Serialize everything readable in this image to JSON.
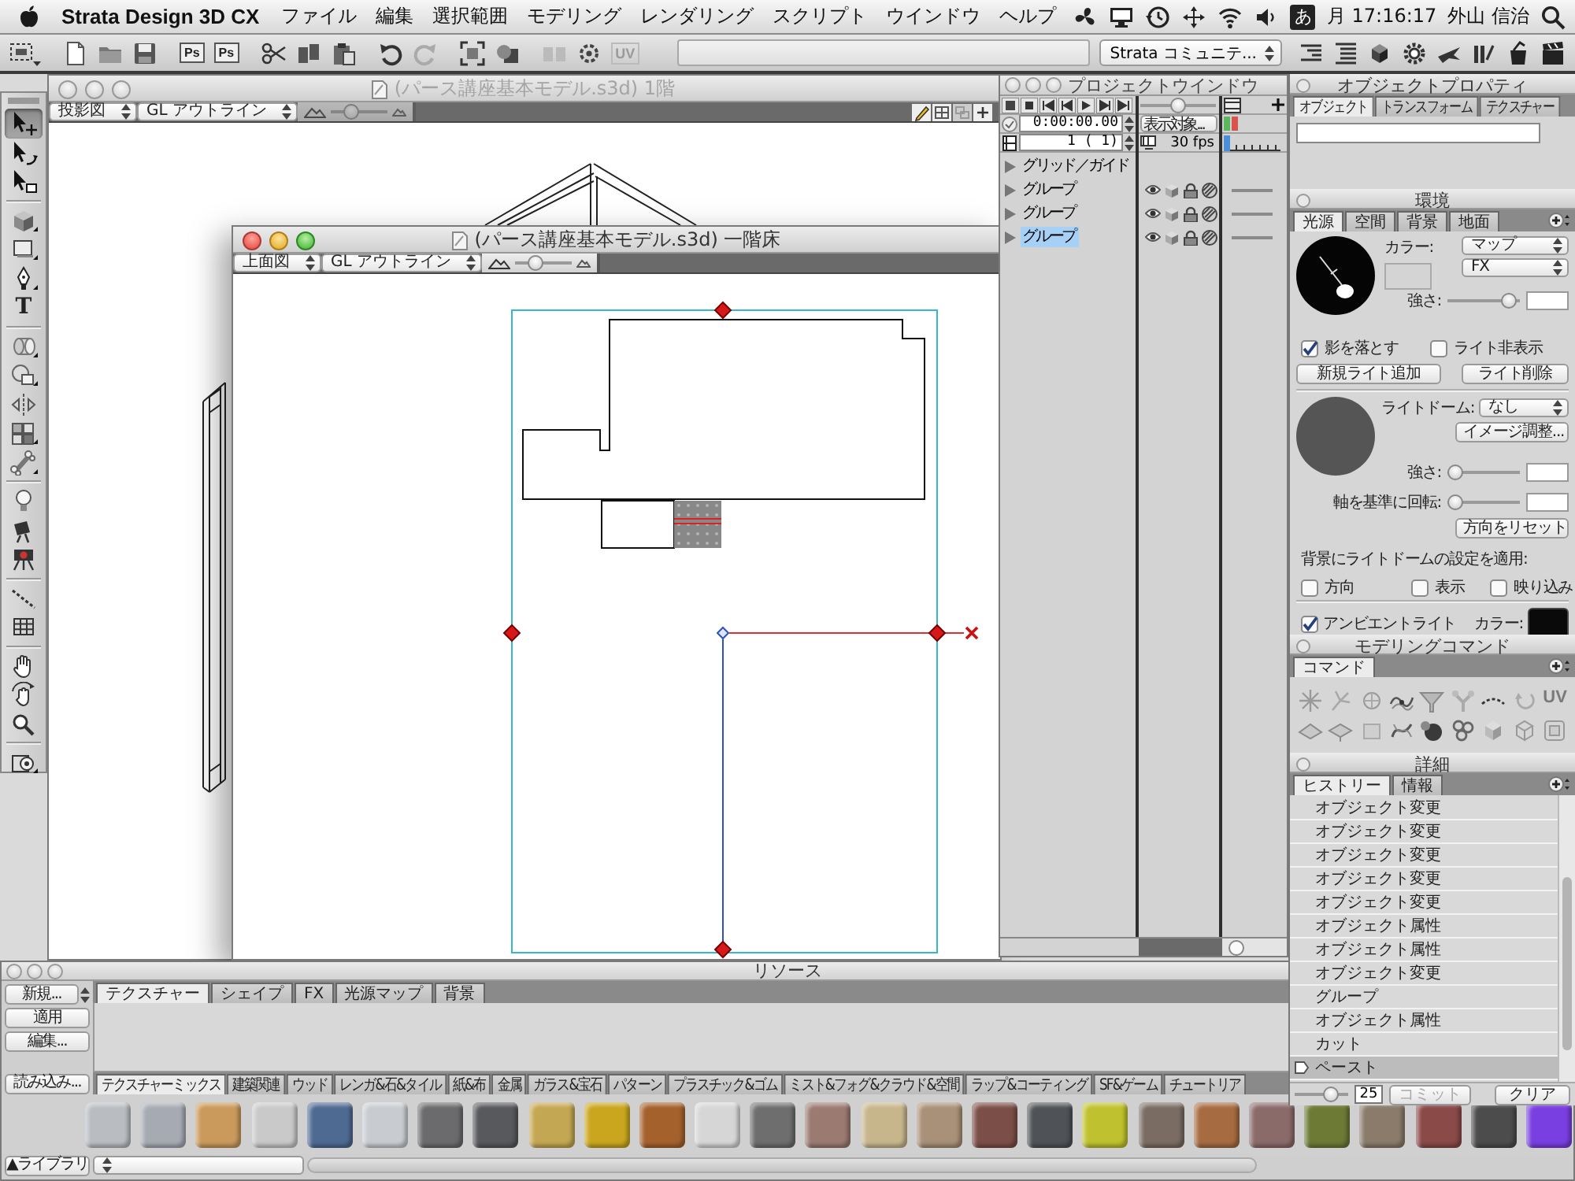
{
  "menu_bar": {
    "app_name": "Strata Design 3D CX",
    "menus": [
      "ファイル",
      "編集",
      "選択範囲",
      "モデリング",
      "レンダリング",
      "スクリプト",
      "ウインドウ",
      "ヘルプ"
    ],
    "input_mode": "あ",
    "clock": "月 17:16:17",
    "user": "外山 信治"
  },
  "toolbar": {
    "export_buttons": [
      "Ps",
      "Ps"
    ],
    "uv_button": "UV",
    "community_select": "Strata コミュニテ..."
  },
  "toolbox": {
    "groups": [
      [
        {
          "kind": "move",
          "selected": true
        },
        {
          "kind": "rotate",
          "selected": false
        },
        {
          "kind": "reshape",
          "selected": false
        }
      ],
      [
        {
          "kind": "cube",
          "selected": false
        },
        {
          "kind": "rectangle",
          "selected": false
        },
        {
          "kind": "pen",
          "selected": false
        },
        {
          "kind": "text",
          "label": "T",
          "selected": false
        }
      ],
      [
        {
          "kind": "extrude",
          "selected": false
        },
        {
          "kind": "lathe",
          "selected": false
        },
        {
          "kind": "mirror",
          "selected": false
        },
        {
          "kind": "replicate",
          "selected": false
        },
        {
          "kind": "bone",
          "selected": false
        }
      ],
      [
        {
          "kind": "light",
          "selected": false
        },
        {
          "kind": "spotlight",
          "selected": false
        },
        {
          "kind": "camera",
          "selected": false
        }
      ],
      [
        {
          "kind": "path",
          "selected": false
        },
        {
          "kind": "grid",
          "selected": false
        }
      ],
      [
        {
          "kind": "hand",
          "selected": false
        },
        {
          "kind": "orbit",
          "selected": false
        },
        {
          "kind": "zoom",
          "selected": false
        }
      ],
      [
        {
          "kind": "render",
          "selected": false
        }
      ]
    ]
  },
  "back_window": {
    "title": "(パース講座基本モデル.s3d) 1階",
    "active": false,
    "view_select": "投影図",
    "render_select": "GL アウトライン",
    "zoom_slider": {
      "level": 0.3
    }
  },
  "front_window": {
    "title": "(パース講座基本モデル.s3d) 一階床",
    "active": true,
    "view_select": "上面図",
    "render_select": "GL アウトライン",
    "zoom_slider": {
      "level": 0.3
    }
  },
  "project_window": {
    "title": "プロジェクトウインドウ",
    "active": false,
    "time": "0:00:00.00",
    "frame": "1 ( 1)",
    "scale_slider": {
      "level": 0.5
    },
    "display_button": "表示対象...",
    "fps": "30 fps",
    "items": [
      {
        "kind": "guide",
        "label": "グリッド／ガイド",
        "selected": false
      },
      {
        "kind": "group",
        "label": "グループ",
        "selected": false
      },
      {
        "kind": "group",
        "label": "グループ",
        "selected": false
      },
      {
        "kind": "group",
        "label": "グループ",
        "selected": true
      }
    ]
  },
  "object_properties": {
    "title": "オブジェクトプロパティ",
    "tabs": [
      {
        "label": "オブジェクト",
        "selected": true
      },
      {
        "label": "トランスフォーム",
        "selected": false
      },
      {
        "label": "テクスチャー",
        "selected": false
      }
    ]
  },
  "environment": {
    "title": "環境",
    "tabs": [
      {
        "label": "光源",
        "selected": true
      },
      {
        "label": "空間",
        "selected": false
      },
      {
        "label": "背景",
        "selected": false
      },
      {
        "label": "地面",
        "selected": false
      }
    ],
    "color_label": "カラー:",
    "map_select": "マップ",
    "fx_select": "FX",
    "intensity": {
      "label": "強さ:",
      "level": 0.95
    },
    "cast_shadow": {
      "label": "影を落とす",
      "checked": true
    },
    "hide_light": {
      "label": "ライト非表示",
      "checked": false
    },
    "add_light_button": "新規ライト追加",
    "delete_light_button": "ライト削除",
    "dome_label": "ライトドーム:",
    "dome_select": "なし",
    "image_adjust_button": "イメージ調整...",
    "dome_intensity": {
      "label": "強さ:",
      "level": 0
    },
    "rotation": {
      "label": "軸を基準に回転:",
      "level": 0
    },
    "reset_button": "方向をリセット",
    "apply_label": "背景にライトドームの設定を適用:",
    "apply_options": [
      {
        "label": "方向",
        "checked": false
      },
      {
        "label": "表示",
        "checked": false
      },
      {
        "label": "映り込み",
        "checked": false
      }
    ],
    "ambient": {
      "label": "アンビエントライト",
      "checked": true
    },
    "ambient_color_label": "カラー:"
  },
  "modeling_commands": {
    "title": "モデリングコマンド",
    "tab": "コマンド",
    "uv_label": "UV"
  },
  "details": {
    "title": "詳細",
    "tabs": [
      {
        "label": "ヒストリー",
        "selected": true
      },
      {
        "label": "情報",
        "selected": false
      }
    ],
    "history": [
      {
        "label": "オブジェクト変更",
        "selected": false
      },
      {
        "label": "オブジェクト変更",
        "selected": false
      },
      {
        "label": "オブジェクト変更",
        "selected": false
      },
      {
        "label": "オブジェクト変更",
        "selected": false
      },
      {
        "label": "オブジェクト変更",
        "selected": false
      },
      {
        "label": "オブジェクト属性",
        "selected": false
      },
      {
        "label": "オブジェクト属性",
        "selected": false
      },
      {
        "label": "オブジェクト変更",
        "selected": false
      },
      {
        "label": "グループ",
        "selected": false
      },
      {
        "label": "オブジェクト属性",
        "selected": false
      },
      {
        "label": "カット",
        "selected": false
      },
      {
        "label": "ペースト",
        "selected": true
      }
    ],
    "undo": {
      "level": 0.75,
      "value": "25"
    },
    "commit_button": {
      "label": "コミット",
      "disabled": true
    },
    "clear_button": {
      "label": "クリア",
      "disabled": false
    }
  },
  "resources": {
    "title": "リソース",
    "new_button": "新規...",
    "apply_button": "適用",
    "edit_button": "編集...",
    "tabs": [
      {
        "label": "テクスチャー",
        "selected": true
      },
      {
        "label": "シェイプ",
        "selected": false
      },
      {
        "label": "FX",
        "selected": false
      },
      {
        "label": "光源マップ",
        "selected": false
      },
      {
        "label": "背景",
        "selected": false
      }
    ],
    "import_button": "読み込み...",
    "categories": [
      {
        "label": "テクスチャーミックス",
        "selected": true
      },
      {
        "label": "建築関連",
        "selected": false
      },
      {
        "label": "ウッド",
        "selected": false
      },
      {
        "label": "レンガ&石&タイル",
        "selected": false
      },
      {
        "label": "紙&布",
        "selected": false
      },
      {
        "label": "金属",
        "selected": false
      },
      {
        "label": "ガラス&宝石",
        "selected": false
      },
      {
        "label": "パターン",
        "selected": false
      },
      {
        "label": "プラスチック&ゴム",
        "selected": false
      },
      {
        "label": "ミスト&フォグ&クラウド&空間",
        "selected": false
      },
      {
        "label": "ラップ&コーティング",
        "selected": false
      },
      {
        "label": "SF&ゲーム",
        "selected": false
      },
      {
        "label": "チュートリア",
        "selected": false
      }
    ],
    "swatches": [
      {
        "color": "#b9bdc2"
      },
      {
        "color": "#a6abb3"
      },
      {
        "color": "#c99a5c"
      },
      {
        "color": "#c9c9c9"
      },
      {
        "color": "#4f6a92"
      },
      {
        "color": "#c8ccd1"
      },
      {
        "color": "#6b6b6d"
      },
      {
        "color": "#58595c"
      },
      {
        "color": "#c4a752"
      },
      {
        "color": "#c9a61e"
      },
      {
        "color": "#a4612c"
      },
      {
        "color": "#d6d6d6"
      },
      {
        "color": "#6e6e6e"
      },
      {
        "color": "#9b7a72"
      },
      {
        "color": "#c7b68c"
      },
      {
        "color": "#a99078"
      },
      {
        "color": "#7b4f47"
      },
      {
        "color": "#4f5357"
      },
      {
        "color": "#bfc12e"
      },
      {
        "color": "#7a6c62"
      },
      {
        "color": "#a66b41"
      },
      {
        "color": "#8b6a6a"
      },
      {
        "color": "#6c7a36"
      },
      {
        "color": "#8a7b6a"
      },
      {
        "color": "#8a4a48"
      },
      {
        "color": "#4c4c4c"
      },
      {
        "color": "#7a3fe0"
      }
    ],
    "library_button": "▲ライブラリ"
  }
}
